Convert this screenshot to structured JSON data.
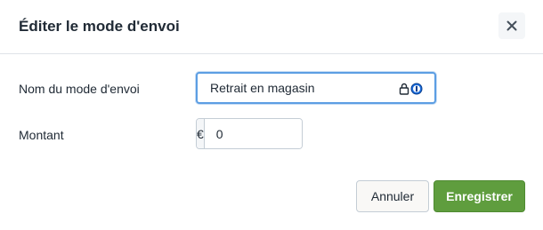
{
  "dialog": {
    "title": "Éditer le mode d'envoi",
    "close_icon": "close-icon"
  },
  "form": {
    "name_label": "Nom du mode d'envoi",
    "name_value": "Retrait en magasin",
    "amount_label": "Montant",
    "currency_symbol": "€",
    "amount_value": "0"
  },
  "password_manager_icons": [
    "lock-icon",
    "1password-icon"
  ],
  "actions": {
    "cancel_label": "Annuler",
    "save_label": "Enregistrer"
  },
  "colors": {
    "primary": "#5f9d3e",
    "focus_border": "#5c9ee3"
  }
}
